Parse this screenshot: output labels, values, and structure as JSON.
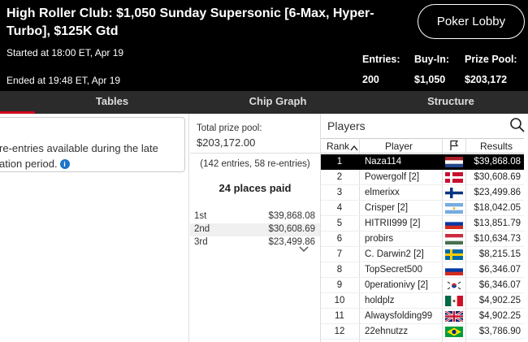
{
  "header": {
    "title": "High Roller Club: $1,050 Sunday Supersonic [6-Max, Hyper-Turbo], $125K Gtd",
    "started": "Started at 18:00 ET, Apr 19",
    "ended": "Ended at 19:48 ET, Apr 19",
    "lobby_button": "Poker Lobby",
    "stats": [
      {
        "label": "Entries:",
        "value": "200"
      },
      {
        "label": "Buy-In:",
        "value": "$1,050"
      },
      {
        "label": "Prize Pool:",
        "value": "$203,172"
      }
    ]
  },
  "tabs": [
    "Tables",
    "Chip Graph",
    "Structure"
  ],
  "left_panel": {
    "note": "re-entries available during the late",
    "note_line2": "ation period."
  },
  "prize_panel": {
    "label": "Total prize pool:",
    "value": "$203,172.00",
    "entries": "(142 entries, 58 re-entries)",
    "places_paid": "24 places paid",
    "payouts": [
      {
        "place": "1st",
        "amount": "$39,868.08"
      },
      {
        "place": "2nd",
        "amount": "$30,608.69"
      },
      {
        "place": "3rd",
        "amount": "$23,499.86"
      }
    ]
  },
  "players_panel": {
    "title": "Players",
    "columns": {
      "rank": "Rank",
      "player": "Player",
      "results": "Results"
    },
    "rows": [
      {
        "rank": "1",
        "name": "Naza114",
        "flag": "netherlands",
        "result": "$39,868.08"
      },
      {
        "rank": "2",
        "name": "Powergolf [2]",
        "flag": "denmark",
        "result": "$30,608.69"
      },
      {
        "rank": "3",
        "name": "elmerixx",
        "flag": "finland",
        "result": "$23,499.86"
      },
      {
        "rank": "4",
        "name": "Crisper [2]",
        "flag": "argentina",
        "result": "$18,042.05"
      },
      {
        "rank": "5",
        "name": "HITRII999 [2]",
        "flag": "russia",
        "result": "$13,851.79"
      },
      {
        "rank": "6",
        "name": "probirs",
        "flag": "hungary",
        "result": "$10,634.73"
      },
      {
        "rank": "7",
        "name": "C. Darwin2 [2]",
        "flag": "sweden",
        "result": "$8,215.15"
      },
      {
        "rank": "8",
        "name": "TopSecret500",
        "flag": "russia",
        "result": "$6,346.07"
      },
      {
        "rank": "9",
        "name": "0perationivy [2]",
        "flag": "south-korea",
        "result": "$6,346.07"
      },
      {
        "rank": "10",
        "name": "holdplz",
        "flag": "mexico",
        "result": "$4,902.25"
      },
      {
        "rank": "11",
        "name": "Alwaysfolding99",
        "flag": "united-kingdom",
        "result": "$4,902.25"
      },
      {
        "rank": "12",
        "name": "22ehnutzz",
        "flag": "brazil",
        "result": "$3,786.90"
      }
    ]
  },
  "colors": {
    "accent": "#d0021b",
    "header_bg": "#000000",
    "tabbar_bg": "#2b2b2b",
    "info": "#1a73c8"
  }
}
